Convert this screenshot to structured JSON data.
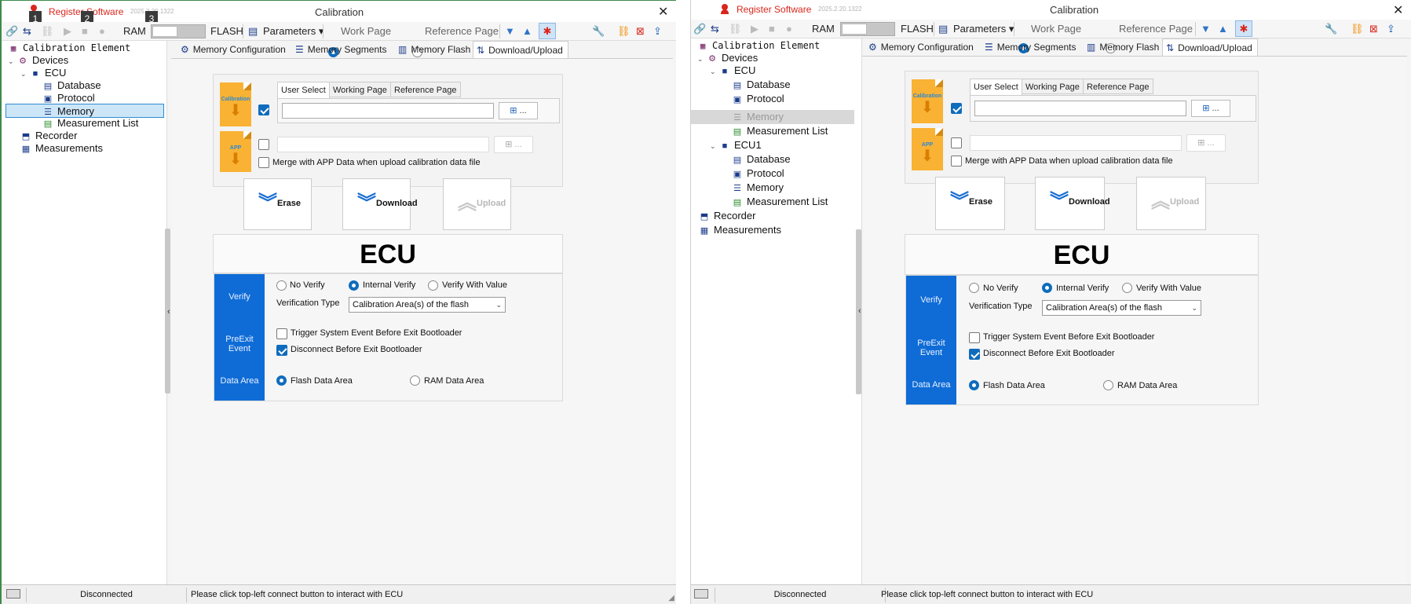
{
  "app": {
    "brand": "Register Software",
    "title": "Calibration",
    "close_glyph": "✕"
  },
  "left_window": {
    "version": "2025.2.20.1322"
  },
  "right_window": {
    "version": "2025.2.20.1322"
  },
  "overlay_badges": [
    "1",
    "2",
    "3"
  ],
  "toolbar": {
    "ram_label": "RAM",
    "flash_label": "FLASH",
    "parameters_label": "Parameters",
    "work_page_label": "Work Page",
    "reference_page_label": "Reference Page",
    "selected_page": "Work Page",
    "icons": [
      "link-icon",
      "connect-icon",
      "disconnect-icon",
      "play-icon",
      "stop-icon",
      "record-icon",
      "filter-down-icon",
      "filter-up-icon",
      "bug-icon",
      "wrench-icon",
      "chain-icon",
      "clear-icon",
      "export-icon"
    ]
  },
  "tree": {
    "root": "Calibration Element",
    "devices": "Devices",
    "ecu": "ECU",
    "ecu1": "ECU1",
    "database": "Database",
    "protocol": "Protocol",
    "memory": "Memory",
    "measurement_list": "Measurement List",
    "recorder": "Recorder",
    "measurements": "Measurements"
  },
  "tabs": [
    "Memory Configuration",
    "Memory Segments",
    "Memory Flash",
    "Download/Upload"
  ],
  "active_tab": "Download/Upload",
  "file_section": {
    "calibration_icon_text": "Calibration",
    "app_icon_text": "APP",
    "subtabs": [
      "User Select",
      "Working Page",
      "Reference Page"
    ],
    "active_subtab": "User Select",
    "calibration_path": "",
    "app_path": "",
    "browse_label": "...",
    "calibration_checked": true,
    "app_checked": false,
    "merge_label": "Merge with APP Data when upload calibration data file",
    "merge_checked": false
  },
  "actions": {
    "erase": "Erase",
    "download": "Download",
    "upload": "Upload"
  },
  "ecu_title": "ECU",
  "verify": {
    "section": "Verify",
    "options": [
      "No Verify",
      "Internal Verify",
      "Verify With Value"
    ],
    "selected": "Internal Verify",
    "type_label": "Verification Type",
    "type_value": "Calibration Area(s) of the flash"
  },
  "preexit": {
    "section": "PreExit Event",
    "trigger_label": "Trigger System Event Before Exit Bootloader",
    "trigger_checked": false,
    "disconnect_label": "Disconnect Before Exit Bootloader",
    "disconnect_checked": true
  },
  "data_area": {
    "section": "Data Area",
    "flash_label": "Flash Data Area",
    "ram_label": "RAM Data Area",
    "selected": "Flash Data Area"
  },
  "status": {
    "connection": "Disconnected",
    "message": "Please click top-left connect button to interact with ECU"
  },
  "colors": {
    "accent": "#0f6cbd",
    "sidebar": "#0f6cd6",
    "brand_red": "#d9261c"
  }
}
